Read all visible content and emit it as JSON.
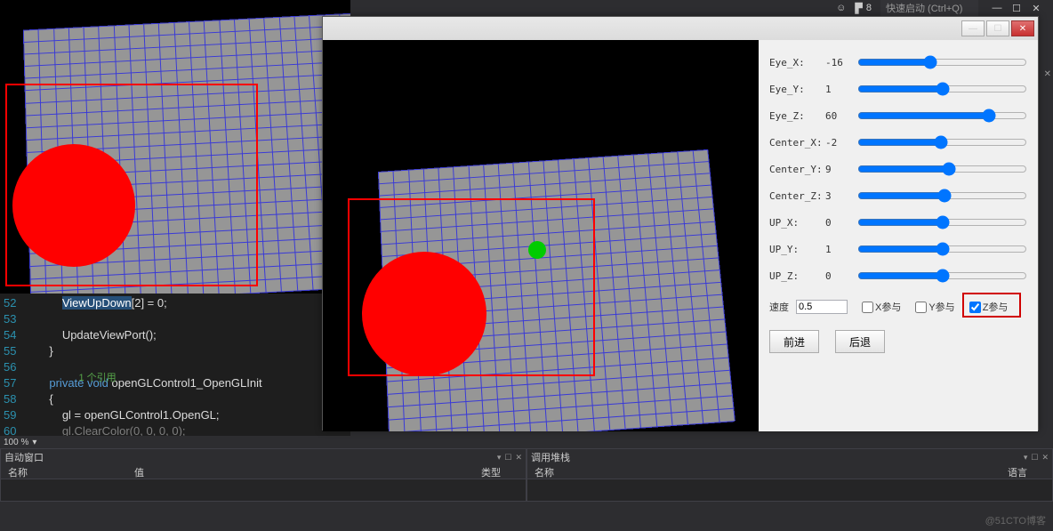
{
  "menubar": {
    "notif_icon": "▮",
    "notif_count": "8",
    "search_placeholder": "快速启动 (Ctrl+Q)",
    "win_min": "—",
    "win_max": "☐",
    "win_close": "✕",
    "feedback_icon": "☺"
  },
  "side_x": "✕",
  "code": {
    "lines": [
      "52",
      "53",
      "54",
      "55",
      "56",
      "57",
      "58",
      "59",
      "60"
    ],
    "l52_sel": "ViewUpDown",
    "l52_rest": "[2] = 0;",
    "l54": "UpdateViewPort();",
    "l55": "}",
    "ref_comment": "1 个引用",
    "l57_kw1": "private",
    "l57_kw2": "void",
    "l57_rest": " openGLControl1_OpenGLInit",
    "l58": "{",
    "l59": "    gl = openGLControl1.OpenGL;",
    "l60": "    gl.ClearColor(0, 0, 0, 0);"
  },
  "zoom": "100 %",
  "panel_left": {
    "title": "自动窗口",
    "col1": "名称",
    "col2": "值",
    "col3": "类型"
  },
  "panel_right": {
    "title": "调用堆栈",
    "col1": "名称",
    "col3": "语言"
  },
  "panel_ctrls": {
    "a": "▾",
    "b": "☐",
    "c": "✕"
  },
  "app": {
    "win_min": "—",
    "win_max": "☐",
    "win_close": "✕"
  },
  "sliders": [
    {
      "label": "Eye_X:",
      "value": "-16"
    },
    {
      "label": "Eye_Y:",
      "value": "1"
    },
    {
      "label": "Eye_Z:",
      "value": "60"
    },
    {
      "label": "Center_X:",
      "value": "-2"
    },
    {
      "label": "Center_Y:",
      "value": "9"
    },
    {
      "label": "Center_Z:",
      "value": "3"
    },
    {
      "label": "UP_X:",
      "value": "0"
    },
    {
      "label": "UP_Y:",
      "value": "1"
    },
    {
      "label": "UP_Z:",
      "value": "0"
    }
  ],
  "speed": {
    "label": "速度",
    "value": "0.5"
  },
  "checks": {
    "x": "X参与",
    "y": "Y参与",
    "z": "Z参与"
  },
  "buttons": {
    "forward": "前进",
    "back": "后退"
  },
  "watermark": "@51CTO博客"
}
